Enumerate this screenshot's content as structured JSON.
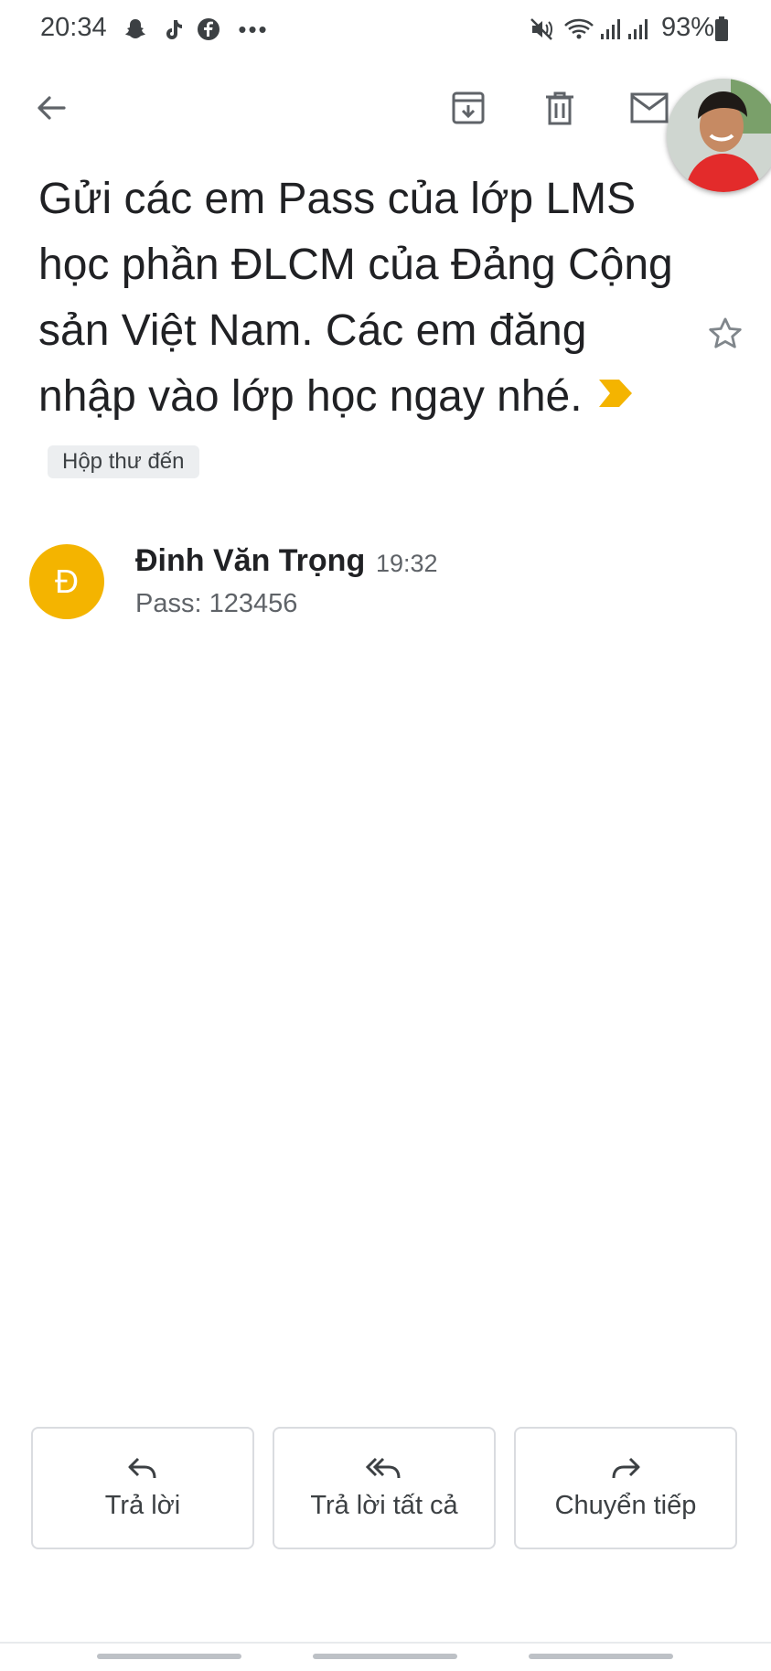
{
  "status_bar": {
    "time": "20:34",
    "left_icons": [
      "snapchat-like-icon",
      "tiktok-icon",
      "facebook-icon",
      "more-dots-icon"
    ],
    "right_icons": [
      "mute-icon",
      "wifi-icon",
      "signal-icon",
      "signal-icon-2",
      "battery-icon"
    ],
    "battery": "93%"
  },
  "toolbar": {
    "back": "back-arrow-icon",
    "archive": "archive-icon",
    "delete": "trash-icon",
    "mark_unread": "mail-icon"
  },
  "email": {
    "subject": "Gửi các em Pass của lớp LMS học phần ĐLCM của Đảng Cộng sản Việt Nam. Các em đăng nhập vào lớp học ngay nhé.",
    "label": "Hộp thư đến",
    "importance_color": "#f4b400",
    "sender_initial": "Đ",
    "sender_name": "Đinh Văn Trọng",
    "time": "19:32",
    "snippet": "Pass: 123456",
    "avatar_color": "#f4b400"
  },
  "actions": {
    "reply": "Trả lời",
    "reply_all": "Trả lời tất cả",
    "forward": "Chuyển tiếp"
  }
}
